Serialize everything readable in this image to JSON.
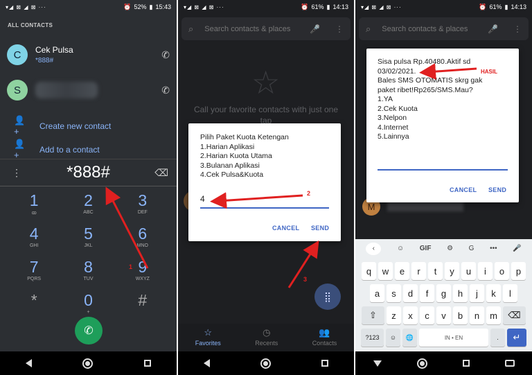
{
  "panel1": {
    "status": {
      "signal": "▾◢ ⊠ ◢ ⊠ ···",
      "alarm_icon": "alarm-icon",
      "battery": "52%",
      "time": "15:43"
    },
    "section_header": "ALL CONTACTS",
    "contacts": [
      {
        "initial": "C",
        "name": "Cek Pulsa",
        "number": "*888#",
        "avatar_color": "#7fd3e6"
      },
      {
        "initial": "S",
        "avatar_color": "#8fd3a0"
      }
    ],
    "actions": [
      {
        "label": "Create new contact",
        "icon": "add-person-icon"
      },
      {
        "label": "Add to a contact",
        "icon": "add-person-icon"
      }
    ],
    "dialed": "*888#",
    "keys": [
      {
        "digit": "1",
        "letters": "ꝏ"
      },
      {
        "digit": "2",
        "letters": "ABC"
      },
      {
        "digit": "3",
        "letters": "DEF"
      },
      {
        "digit": "4",
        "letters": "GHI"
      },
      {
        "digit": "5",
        "letters": "JKL"
      },
      {
        "digit": "6",
        "letters": "MNO"
      },
      {
        "digit": "7",
        "letters": "PQRS"
      },
      {
        "digit": "8",
        "letters": "TUV"
      },
      {
        "digit": "9",
        "letters": "WXYZ"
      },
      {
        "digit": "*",
        "letters": ""
      },
      {
        "digit": "0",
        "letters": "+"
      },
      {
        "digit": "#",
        "letters": ""
      }
    ],
    "annotation": "1"
  },
  "panel2": {
    "status": {
      "signal": "▾◢ ⊠ ◢ ⊠ ···",
      "battery": "61%",
      "time": "14:13"
    },
    "search_placeholder": "Search contacts & places",
    "favorites_text": "Call your favorite contacts with just one tap",
    "dialog": {
      "lines": [
        "Pilih Paket Kuota Ketengan",
        "1.Harian Aplikasi",
        "2.Harian Kuota Utama",
        "3.Bulanan Aplikasi",
        "4.Cek Pulsa&Kuota"
      ],
      "input_value": "4",
      "cancel": "CANCEL",
      "send": "SEND"
    },
    "annotation_2": "2",
    "annotation_3": "3",
    "bottom_nav": [
      {
        "label": "Favorites",
        "icon": "star-icon",
        "active": true
      },
      {
        "label": "Recents",
        "icon": "clock-icon",
        "active": false
      },
      {
        "label": "Contacts",
        "icon": "people-icon",
        "active": false
      }
    ]
  },
  "panel3": {
    "status": {
      "signal": "▾◢ ⊠ ◢ ⊠ ···",
      "battery": "61%",
      "time": "14:13"
    },
    "search_placeholder": "Search contacts & places",
    "dialog": {
      "lines": [
        "Sisa pulsa Rp.40480.Aktif sd",
        "03/02/2021.",
        "Bales SMS OTOMATIS skrg gak",
        "paket ribet!Rp265/SMS.Mau?",
        "1.YA",
        "2.Cek Kuota",
        "3.Nelpon",
        "4.Internet",
        "5.Lainnya"
      ],
      "cancel": "CANCEL",
      "send": "SEND"
    },
    "annotation": "HASIL",
    "contact_initial": "M",
    "keyboard": {
      "toolbar": [
        "‹",
        "☺",
        "GIF",
        "⚙",
        "G",
        "•••",
        "🎤"
      ],
      "row1": [
        "q",
        "w",
        "e",
        "r",
        "t",
        "y",
        "u",
        "i",
        "o",
        "p"
      ],
      "row1_hints": [
        "1",
        "2",
        "3",
        "4",
        "5",
        "6",
        "7",
        "8",
        "9",
        "0"
      ],
      "row2": [
        "a",
        "s",
        "d",
        "f",
        "g",
        "h",
        "j",
        "k",
        "l"
      ],
      "row3": [
        "⇧",
        "z",
        "x",
        "c",
        "v",
        "b",
        "n",
        "m",
        "⌫"
      ],
      "row4": [
        "?123",
        "☺",
        "🌐",
        "IN • EN",
        ".",
        "↵"
      ]
    }
  },
  "colors": {
    "accent_blue": "#8ab4f8",
    "dialog_blue": "#3f66c4",
    "call_green": "#1e9e5a",
    "annotation_red": "#e02020"
  }
}
